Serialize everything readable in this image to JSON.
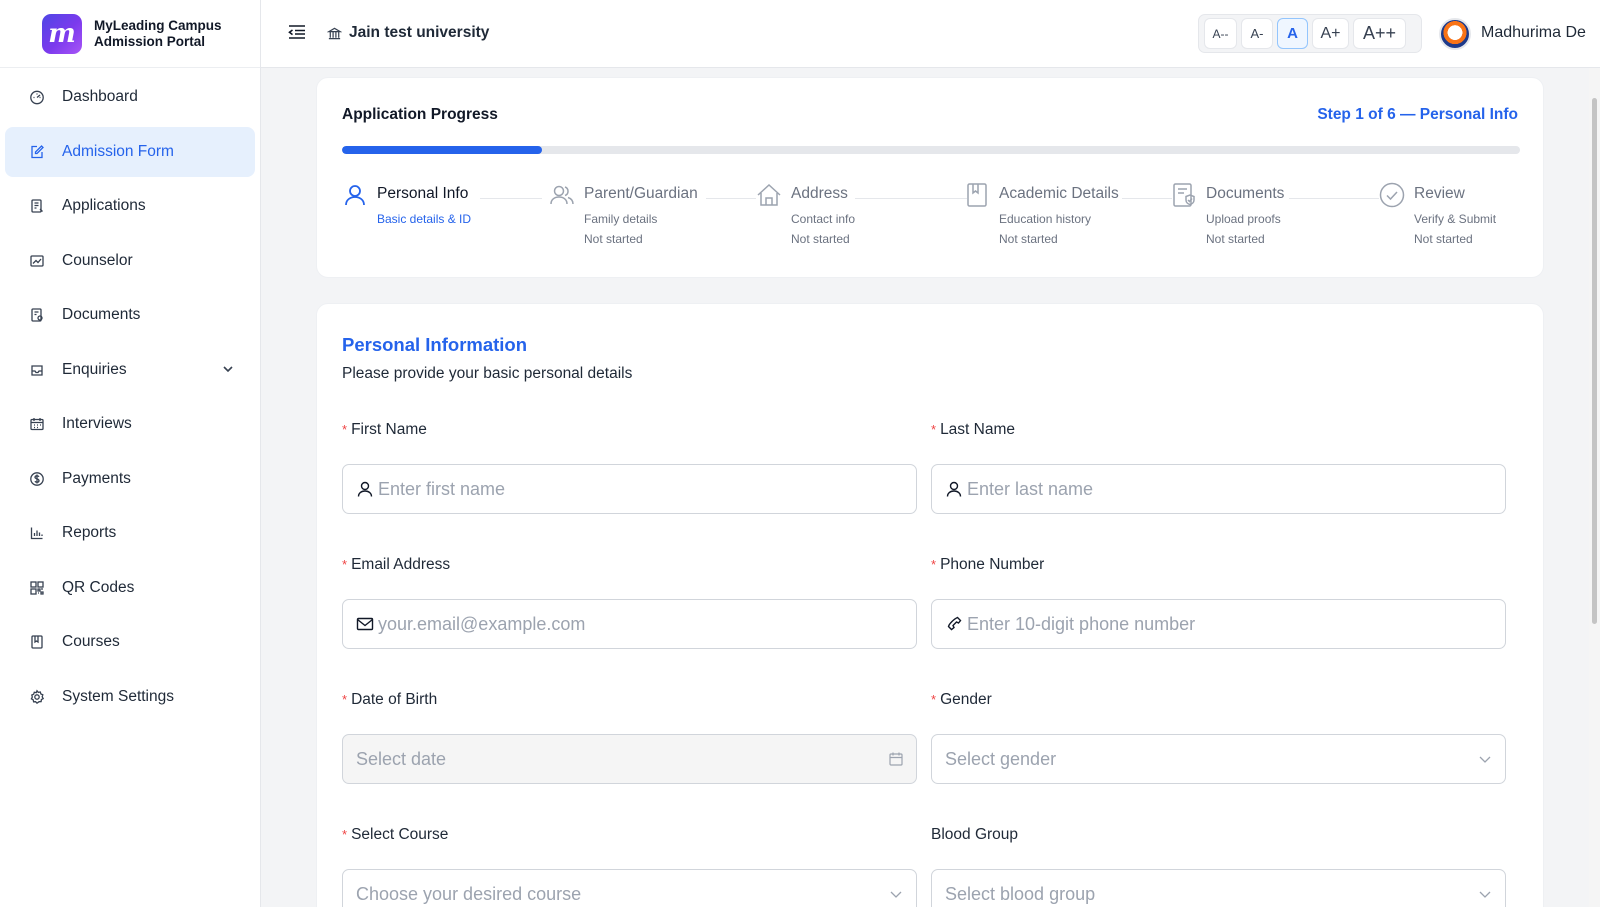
{
  "brand": {
    "logo_letter": "m",
    "line1": "MyLeading Campus",
    "line2": "Admission Portal"
  },
  "header": {
    "university": "Jain test university",
    "font_sizes": [
      "A--",
      "A-",
      "A",
      "A+",
      "A++"
    ],
    "active_font_size": "A",
    "username": "Madhurima De"
  },
  "sidebar": {
    "items": [
      {
        "label": "Dashboard",
        "icon": "dashboard-icon"
      },
      {
        "label": "Admission Form",
        "icon": "edit-form-icon",
        "active": true
      },
      {
        "label": "Applications",
        "icon": "applications-icon"
      },
      {
        "label": "Counselor",
        "icon": "counselor-chart-icon"
      },
      {
        "label": "Documents",
        "icon": "documents-icon"
      },
      {
        "label": "Enquiries",
        "icon": "inbox-icon",
        "has_submenu": true
      },
      {
        "label": "Interviews",
        "icon": "calendar-icon"
      },
      {
        "label": "Payments",
        "icon": "dollar-icon"
      },
      {
        "label": "Reports",
        "icon": "bar-chart-icon"
      },
      {
        "label": "QR Codes",
        "icon": "qr-code-icon"
      },
      {
        "label": "Courses",
        "icon": "book-icon"
      },
      {
        "label": "System Settings",
        "icon": "gear-icon"
      }
    ]
  },
  "progress": {
    "title": "Application Progress",
    "step_indicator": "Step 1 of 6 — Personal Info",
    "percent": 17,
    "steps": [
      {
        "title": "Personal Info",
        "subtitle": "Basic details & ID",
        "status": "",
        "icon": "user-icon",
        "active": true
      },
      {
        "title": "Parent/Guardian",
        "subtitle": "Family details",
        "status": "Not started",
        "icon": "users-icon"
      },
      {
        "title": "Address",
        "subtitle": "Contact info",
        "status": "Not started",
        "icon": "home-icon"
      },
      {
        "title": "Academic Details",
        "subtitle": "Education history",
        "status": "Not started",
        "icon": "book-icon"
      },
      {
        "title": "Documents",
        "subtitle": "Upload proofs",
        "status": "Not started",
        "icon": "file-check-icon"
      },
      {
        "title": "Review",
        "subtitle": "Verify & Submit",
        "status": "Not started",
        "icon": "check-circle-icon"
      }
    ]
  },
  "form": {
    "title": "Personal Information",
    "subtitle": "Please provide your basic personal details",
    "fields": {
      "first_name": {
        "label": "First Name",
        "placeholder": "Enter first name",
        "required": true
      },
      "last_name": {
        "label": "Last Name",
        "placeholder": "Enter last name",
        "required": true
      },
      "email": {
        "label": "Email Address",
        "placeholder": "your.email@example.com",
        "required": true
      },
      "phone": {
        "label": "Phone Number",
        "placeholder": "Enter 10-digit phone number",
        "required": true
      },
      "dob": {
        "label": "Date of Birth",
        "placeholder": "Select date",
        "required": true
      },
      "gender": {
        "label": "Gender",
        "placeholder": "Select gender",
        "required": true
      },
      "course": {
        "label": "Select Course",
        "placeholder": "Choose your desired course",
        "required": true
      },
      "blood_group": {
        "label": "Blood Group",
        "placeholder": "Select blood group",
        "required": false
      }
    }
  },
  "colors": {
    "accent": "#2563eb",
    "active_bg": "#e6f0fd",
    "required": "#ef4444"
  }
}
